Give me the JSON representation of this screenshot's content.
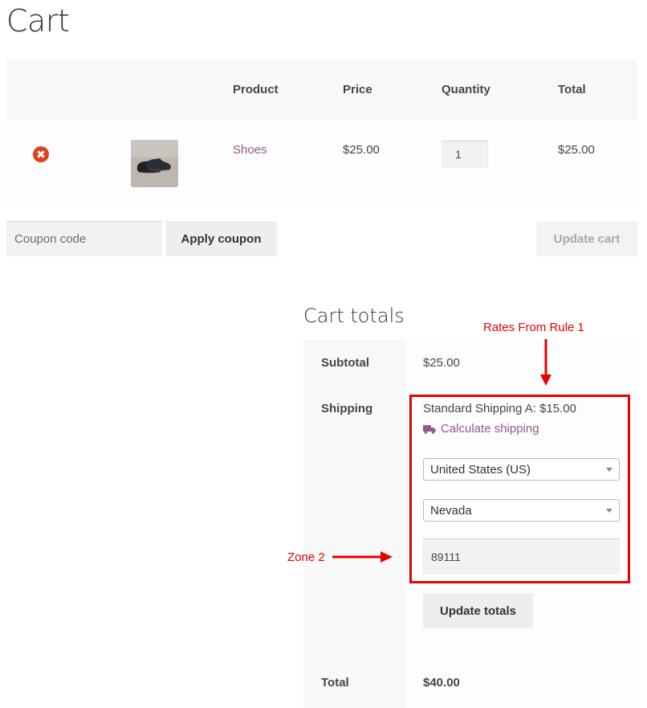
{
  "page": {
    "title": "Cart"
  },
  "cart_table": {
    "headers": {
      "product": "Product",
      "price": "Price",
      "quantity": "Quantity",
      "total": "Total"
    },
    "rows": [
      {
        "remove_glyph": "✖",
        "thumbnail_icon": "shoes-thumbnail",
        "product": "Shoes",
        "price": "$25.00",
        "quantity": "1",
        "total": "$25.00"
      }
    ]
  },
  "coupon": {
    "placeholder": "Coupon code",
    "apply_label": "Apply coupon"
  },
  "update_cart_label": "Update cart",
  "totals": {
    "title": "Cart totals",
    "subtotal_label": "Subtotal",
    "subtotal_value": "$25.00",
    "shipping_label": "Shipping",
    "shipping_method": "Standard Shipping A: $15.00",
    "calculate_label": "Calculate shipping",
    "country": "United States (US)",
    "state": "Nevada",
    "postcode": "89111",
    "update_totals_label": "Update totals",
    "total_label": "Total",
    "total_value": "$40.00"
  },
  "annotations": {
    "rates": "Rates From Rule 1",
    "zone": "Zone 2",
    "color": "#e60000"
  },
  "colors": {
    "link": "#96588a",
    "remove": "#e2401c"
  }
}
